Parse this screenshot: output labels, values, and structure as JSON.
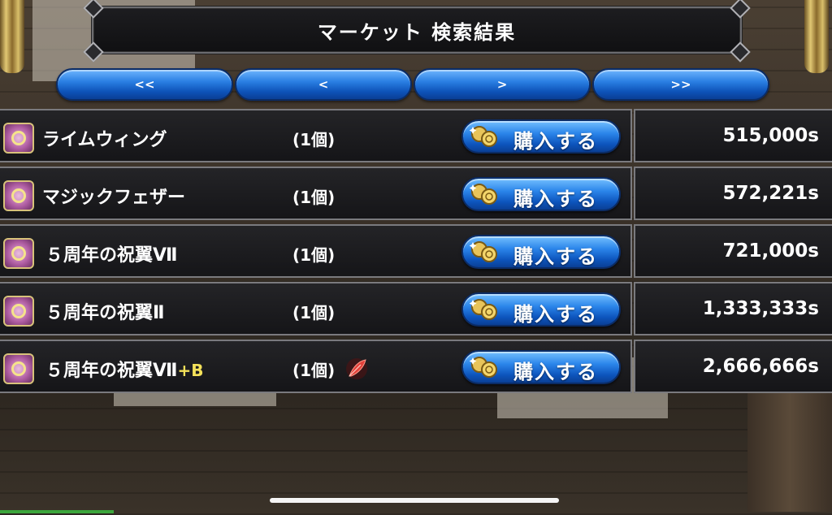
{
  "header": {
    "title": "マーケット 検索結果"
  },
  "pagination": {
    "first": "<<",
    "prev": "<",
    "next": ">",
    "last": ">>"
  },
  "listings": [
    {
      "name": "ライムウィング",
      "suffix": "",
      "quantity": "(1個)",
      "buy_label": "購入する",
      "price": "515,000s",
      "bound_icon": false
    },
    {
      "name": "マジックフェザー",
      "suffix": "",
      "quantity": "(1個)",
      "buy_label": "購入する",
      "price": "572,221s",
      "bound_icon": false
    },
    {
      "name": "５周年の祝翼Ⅶ",
      "suffix": "",
      "quantity": "(1個)",
      "buy_label": "購入する",
      "price": "721,000s",
      "bound_icon": false
    },
    {
      "name": "５周年の祝翼Ⅱ",
      "suffix": "",
      "quantity": "(1個)",
      "buy_label": "購入する",
      "price": "1,333,333s",
      "bound_icon": false
    },
    {
      "name": "５周年の祝翼Ⅶ",
      "suffix": "+B",
      "quantity": "(1個)",
      "buy_label": "購入する",
      "price": "2,666,666s",
      "bound_icon": true
    }
  ],
  "colors": {
    "button_blue": "#2a7fe3",
    "suffix_yellow": "#f4e15a",
    "row_bg": "#1b1b1e",
    "item_icon": "#b05ea3"
  },
  "icons": {
    "item": "wing-item-icon",
    "buy": "coin-icon",
    "bound": "feather-bind-icon"
  }
}
